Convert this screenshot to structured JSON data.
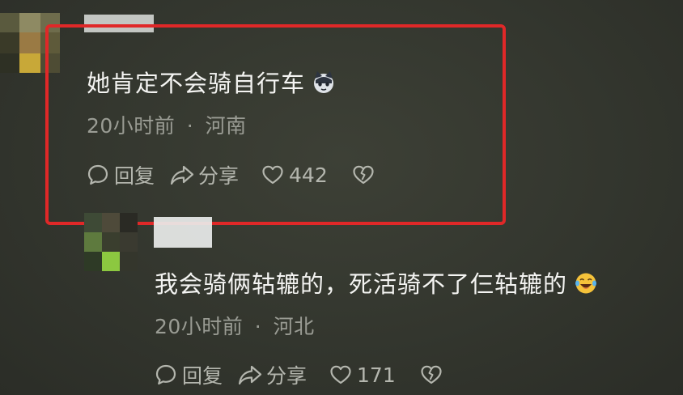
{
  "comments": [
    {
      "text": "她肯定不会骑自行车",
      "emoji_icon": "cat-face-icon",
      "time": "20小时前",
      "separator": "·",
      "location": "河南",
      "reply_label": "回复",
      "share_label": "分享",
      "like_count": "442"
    },
    {
      "text": "我会骑俩轱辘的，死活骑不了仨轱辘的",
      "emoji_icon": "laughing-tears-icon",
      "time": "20小时前",
      "separator": "·",
      "location": "河北",
      "reply_label": "回复",
      "share_label": "分享",
      "like_count": "171"
    }
  ],
  "colors": {
    "highlight_border": "#e02828",
    "background": "#33362e",
    "meta_text": "#9a9c94"
  }
}
